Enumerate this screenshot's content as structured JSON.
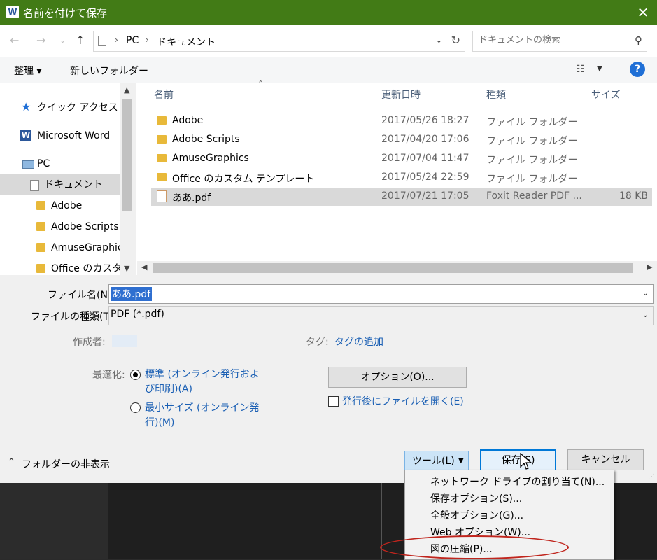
{
  "window": {
    "title": "名前を付けて保存",
    "app_icon": "W",
    "close_glyph": "✕"
  },
  "address": {
    "crumbs": [
      "PC",
      "ドキュメント"
    ],
    "search_placeholder": "ドキュメントの検索"
  },
  "toolbar": {
    "organize": "整理 ▾",
    "new_folder": "新しいフォルダー"
  },
  "nav": {
    "items": [
      {
        "label": "クイック アクセス",
        "icon": "star-icon"
      },
      {
        "label": "Microsoft Word",
        "icon": "word-icon"
      },
      {
        "label": "PC",
        "icon": "pc-icon"
      },
      {
        "label": "ドキュメント",
        "icon": "document-icon"
      },
      {
        "label": "Adobe",
        "icon": "folder-icon"
      },
      {
        "label": "Adobe Scripts",
        "icon": "folder-icon"
      },
      {
        "label": "AmuseGraphics",
        "icon": "folder-icon"
      },
      {
        "label": "Office のカスタム",
        "icon": "folder-icon"
      }
    ]
  },
  "files": {
    "columns": [
      "名前",
      "更新日時",
      "種類",
      "サイズ"
    ],
    "rows": [
      {
        "name": "Adobe",
        "date": "2017/05/26 18:27",
        "type": "ファイル フォルダー",
        "size": ""
      },
      {
        "name": "Adobe Scripts",
        "date": "2017/04/20 17:06",
        "type": "ファイル フォルダー",
        "size": ""
      },
      {
        "name": "AmuseGraphics",
        "date": "2017/07/04 11:47",
        "type": "ファイル フォルダー",
        "size": ""
      },
      {
        "name": "Office のカスタム テンプレート",
        "date": "2017/05/24 22:59",
        "type": "ファイル フォルダー",
        "size": ""
      },
      {
        "name": "ああ.pdf",
        "date": "2017/07/21 17:05",
        "type": "Foxit Reader PDF ...",
        "size": "18 KB"
      }
    ]
  },
  "form": {
    "filename_label": "ファイル名(N):",
    "filename_value": "ああ.pdf",
    "filetype_label": "ファイルの種類(T):",
    "filetype_value": "PDF (*.pdf)",
    "author_label": "作成者:",
    "tags_label": "タグ:",
    "tags_value": "タグの追加",
    "optimize_label": "最適化:",
    "opt_standard_1": "標準 (オンライン発行およ",
    "opt_standard_2": "び印刷)(A)",
    "opt_min_1": "最小サイズ (オンライン発",
    "opt_min_2": "行)(M)",
    "options_button": "オプション(O)...",
    "open_after": "発行後にファイルを開く(E)"
  },
  "footer": {
    "hide_folders": "フォルダーの非表示",
    "tools": "ツール(L)",
    "save": "保存(S)",
    "cancel": "キャンセル"
  },
  "tools_menu": [
    "ネットワーク ドライブの割り当て(N)...",
    "保存オプション(S)...",
    "全般オプション(G)...",
    "Web オプション(W)...",
    "図の圧縮(P)..."
  ],
  "colors": {
    "titlebar": "#427b16",
    "accent": "#0078d7",
    "highlight_ellipse": "#c0251d"
  }
}
